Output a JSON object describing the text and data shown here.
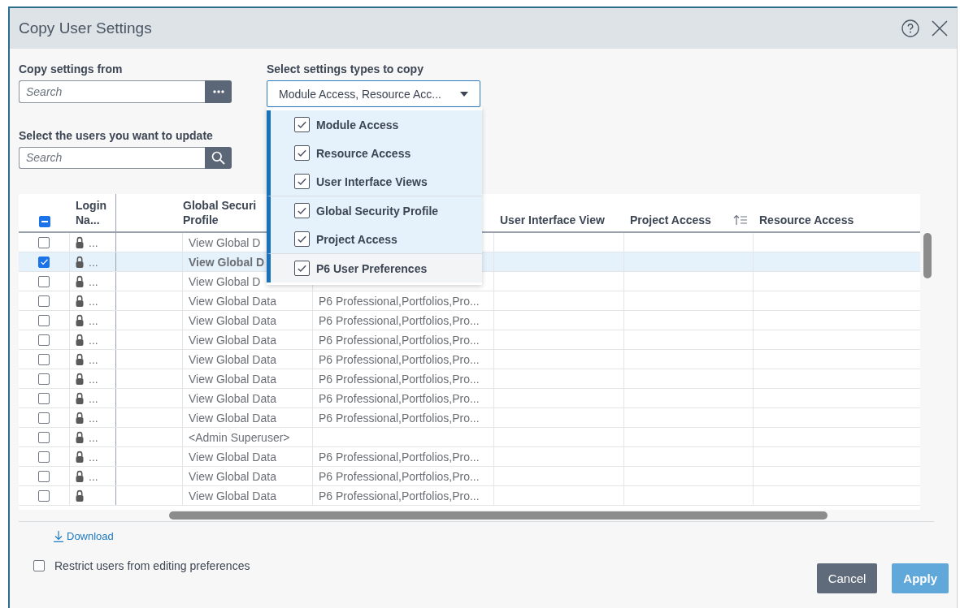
{
  "window": {
    "title": "Copy User Settings"
  },
  "copy_from": {
    "label": "Copy settings from",
    "placeholder": "Search"
  },
  "users_search": {
    "label": "Select the users you want to update",
    "placeholder": "Search"
  },
  "settings_types": {
    "label": "Select settings types to copy",
    "value": "Module Access, Resource Acc...",
    "expanded": true,
    "groups": [
      {
        "items": [
          {
            "label": "Module Access",
            "checked": true,
            "highlighted": true
          },
          {
            "label": "Resource Access",
            "checked": true,
            "highlighted": true
          },
          {
            "label": "User Interface Views",
            "checked": true,
            "highlighted": true
          }
        ]
      },
      {
        "items": [
          {
            "label": "Global Security Profile",
            "checked": true,
            "highlighted": true
          },
          {
            "label": "Project Access",
            "checked": true,
            "highlighted": true
          }
        ]
      },
      {
        "items": [
          {
            "label": "P6 User Preferences",
            "checked": true,
            "highlighted": false
          }
        ]
      }
    ]
  },
  "table": {
    "select_all_partial": true,
    "columns": [
      {
        "label": "Login Na..."
      },
      {},
      {
        "label": "Global Securi Profile"
      },
      {},
      {
        "label": "User Interface View"
      },
      {
        "label": "Project Access",
        "sorted": true
      },
      {
        "label": "Resource Access"
      }
    ],
    "rows": [
      {
        "selected": false,
        "login": "...",
        "global": "View Global D"
      },
      {
        "selected": true,
        "login": "...",
        "global": "View Global D"
      },
      {
        "selected": false,
        "login": "...",
        "global": "View Global D"
      },
      {
        "selected": false,
        "login": "...",
        "global": "View Global Data",
        "module": "P6 Professional,Portfolios,Pro..."
      },
      {
        "selected": false,
        "login": "...",
        "global": "View Global Data",
        "module": "P6 Professional,Portfolios,Pro..."
      },
      {
        "selected": false,
        "login": "...",
        "global": "View Global Data",
        "module": "P6 Professional,Portfolios,Pro..."
      },
      {
        "selected": false,
        "login": "...",
        "global": "View Global Data",
        "module": "P6 Professional,Portfolios,Pro..."
      },
      {
        "selected": false,
        "login": "...",
        "global": "View Global Data",
        "module": "P6 Professional,Portfolios,Pro..."
      },
      {
        "selected": false,
        "login": "...",
        "global": "View Global Data",
        "module": "P6 Professional,Portfolios,Pro..."
      },
      {
        "selected": false,
        "login": "...",
        "global": "View Global Data",
        "module": "P6 Professional,Portfolios,Pro..."
      },
      {
        "selected": false,
        "login": "...",
        "global": "<Admin Superuser>"
      },
      {
        "selected": false,
        "login": "...",
        "global": "View Global Data",
        "module": "P6 Professional,Portfolios,Pro..."
      },
      {
        "selected": false,
        "login": "...",
        "global": "View Global Data",
        "module": "P6 Professional,Portfolios,Pro..."
      },
      {
        "selected": false,
        "global": "View Global Data",
        "module": "P6 Professional,Portfolios,Pro..."
      }
    ]
  },
  "download": "Download",
  "restrict": {
    "label": "Restrict users from editing preferences",
    "checked": false
  },
  "buttons": [
    {
      "label": "Cancel",
      "kind": "secondary"
    },
    {
      "label": "Apply",
      "kind": "primary"
    }
  ]
}
